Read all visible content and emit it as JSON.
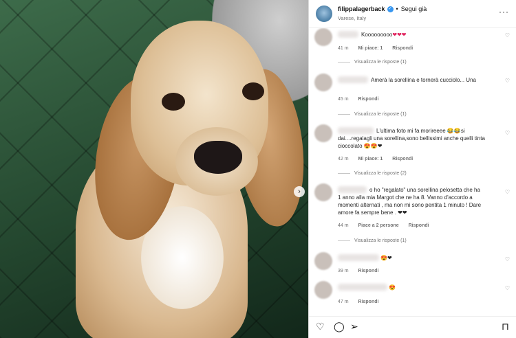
{
  "post": {
    "username": "filippalagerback",
    "verified_glyph": "✓",
    "separator": "•",
    "follow_label": "Segui già",
    "location": "Varese, Italy",
    "more_glyph": "···",
    "next_glyph": "›"
  },
  "comments": [
    {
      "text": "Kooooooooo",
      "emoji": "❤❤❤",
      "time": "41 m",
      "likes": "Mi piace: 1",
      "reply": "Rispondi",
      "view_replies": "Visualizza le risposte (1)"
    },
    {
      "text": "Amerà la sorellina e tornerà cucciolo... Una",
      "emoji": "",
      "time": "45 m",
      "likes": "",
      "reply": "Rispondi",
      "view_replies": "Visualizza le risposte (1)"
    },
    {
      "text_lines": [
        "L'ultima foto mi fa morireeee 😂😂si",
        "dai....regalagli una sorellina,sono bellissimi anche quelli tinta",
        "cioccolato 😍😍❤"
      ],
      "time": "42 m",
      "likes": "Mi piace: 1",
      "reply": "Rispondi",
      "view_replies": "Visualizza le risposte (2)"
    },
    {
      "text_lines": [
        "o ho \"regalato\" una sorellina pelosetta che ha",
        "1 anno alla mia Margot che ne ha 8. Vanno d'accordo a",
        "momenti alternati , ma non mi sono pentita 1 minuto ! Dare",
        "amore fa sempre bene . ❤❤"
      ],
      "time": "44 m",
      "likes": "Piace a 2 persone",
      "reply": "Rispondi",
      "view_replies": "Visualizza le risposte (1)"
    },
    {
      "text": "😍❤",
      "time": "39 m",
      "likes": "",
      "reply": "Rispondi"
    },
    {
      "text": "😍",
      "time": "47 m",
      "likes": "",
      "reply": "Rispondi"
    }
  ],
  "icons": {
    "heart": "♡",
    "comment": "◯",
    "share": "➢",
    "save": "⊓"
  }
}
